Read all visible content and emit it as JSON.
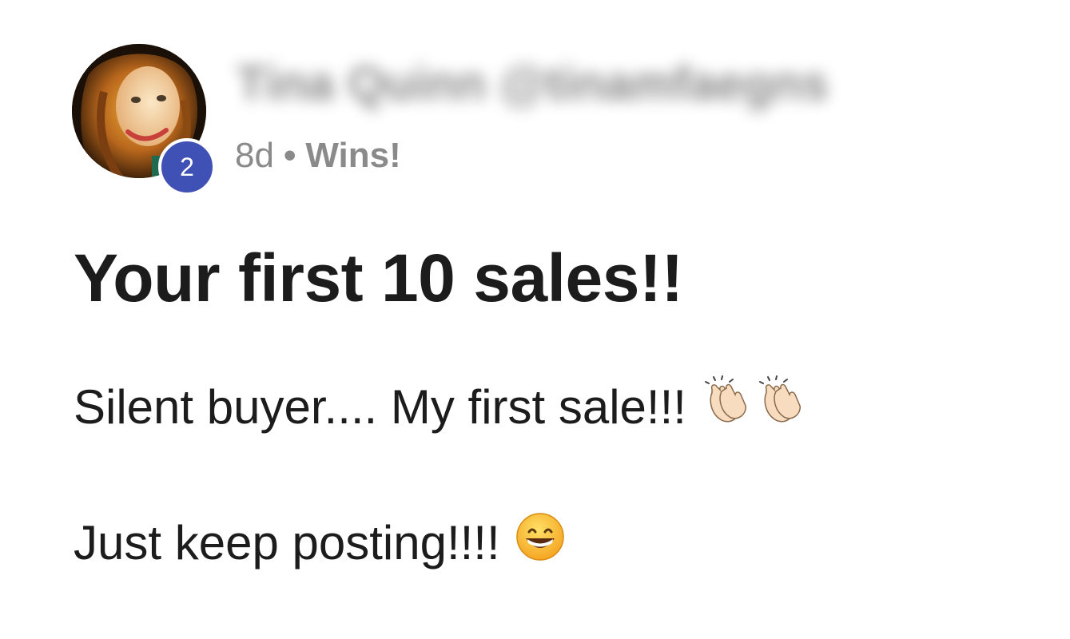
{
  "post": {
    "author": {
      "name": "Tina Quinn @tinamfaegns",
      "level": "2",
      "avatar_icon": "avatar-photo"
    },
    "meta": {
      "time": "8d",
      "separator": "•",
      "category": "Wins!"
    },
    "title": "Your first 10 sales!!",
    "body": {
      "line1": "Silent buyer.... My first sale!!!",
      "line1_emojis": [
        "clapping-hands-icon",
        "clapping-hands-icon"
      ],
      "line2": "Just keep posting!!!!",
      "line2_emojis": [
        "grinning-face-icon"
      ]
    }
  },
  "colors": {
    "badge": "#3f51b5",
    "meta_text": "#8a8a8a",
    "text": "#1c1c1c"
  }
}
